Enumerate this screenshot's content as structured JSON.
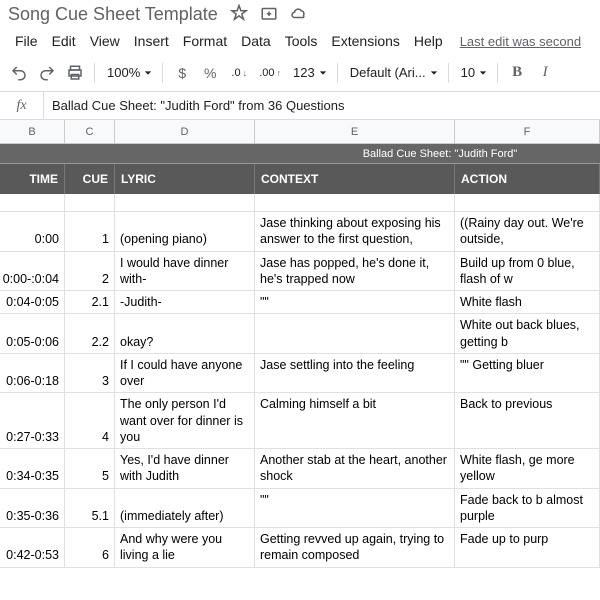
{
  "titlebar": {
    "doc_title": "Song Cue Sheet Template"
  },
  "menu": {
    "file": "File",
    "edit": "Edit",
    "view": "View",
    "insert": "Insert",
    "format": "Format",
    "data": "Data",
    "tools": "Tools",
    "extensions": "Extensions",
    "help": "Help",
    "last_edit": "Last edit was second"
  },
  "toolbar": {
    "zoom": "100%",
    "decimal_dec": ".0",
    "decimal_inc": ".00",
    "num_format": "123",
    "font": "Default (Ari...",
    "font_size": "10"
  },
  "formula": {
    "label": "fx",
    "value": "Ballad Cue Sheet: \"Judith Ford\" from 36 Questions"
  },
  "columns": {
    "B": "B",
    "C": "C",
    "D": "D",
    "E": "E",
    "F": "F"
  },
  "merged_title": "Ballad Cue Sheet: \"Judith Ford\"",
  "headers": {
    "time": "TIME",
    "cue": "CUE",
    "lyric": "LYRIC",
    "context": "CONTEXT",
    "action": "ACTION"
  },
  "rows": [
    {
      "time": "0:00",
      "cue": "1",
      "lyric": "(opening piano)",
      "context": "Jase thinking about exposing his answer to the first question,",
      "action": "((Rainy day out. We're outside,"
    },
    {
      "time": "0:00-:0:04",
      "cue": "2",
      "lyric": "I would have dinner with-",
      "context": "Jase has popped, he's done it, he's trapped now",
      "action": "Build up from 0 blue, flash of w"
    },
    {
      "time": "0:04-0:05",
      "cue": "2.1",
      "lyric": "-Judith-",
      "context": "\"\"",
      "action": "White flash"
    },
    {
      "time": "0:05-0:06",
      "cue": "2.2",
      "lyric": "okay?",
      "context": "",
      "action": "White out back blues, getting b"
    },
    {
      "time": "0:06-0:18",
      "cue": "3",
      "lyric": "If I could have anyone over",
      "context": "Jase settling into the feeling",
      "action": "\"\" Getting bluer"
    },
    {
      "time": "0:27-0:33",
      "cue": "4",
      "lyric": "The only person I'd want over for dinner is you",
      "context": "Calming himself a bit",
      "action": "Back to previous"
    },
    {
      "time": "0:34-0:35",
      "cue": "5",
      "lyric": "Yes, I'd have dinner with Judith",
      "context": "Another stab at the heart, another shock",
      "action": "White flash, ge more yellow"
    },
    {
      "time": "0:35-0:36",
      "cue": "5.1",
      "lyric": "(immediately after)",
      "context": "\"\"",
      "action": "Fade back to b almost purple"
    },
    {
      "time": "0:42-0:53",
      "cue": "6",
      "lyric": "And why were you living a lie",
      "context": "Getting revved up again, trying to remain composed",
      "action": "Fade up to purp"
    }
  ]
}
